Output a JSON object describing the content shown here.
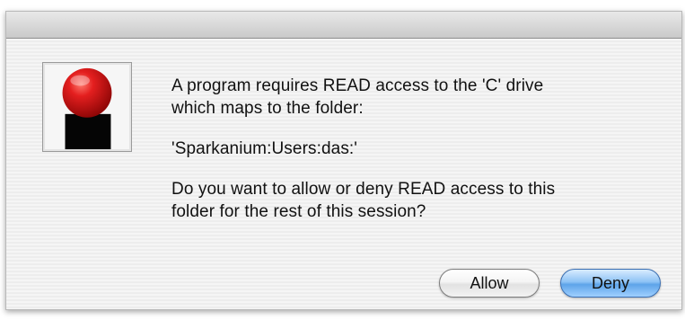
{
  "dialog": {
    "icon": "red-ball-app-icon",
    "message": {
      "line1": "A program requires READ access to the 'C' drive",
      "line2": "which maps to the folder:",
      "folder": "'Sparkanium:Users:das:'",
      "question_line1": "Do you want to allow or deny READ access to this",
      "question_line2": "folder for the rest of this session?"
    },
    "buttons": {
      "allow_label": "Allow",
      "deny_label": "Deny"
    },
    "colors": {
      "icon_red": "#d41818",
      "default_button_blue": "#5ea4e9"
    }
  }
}
